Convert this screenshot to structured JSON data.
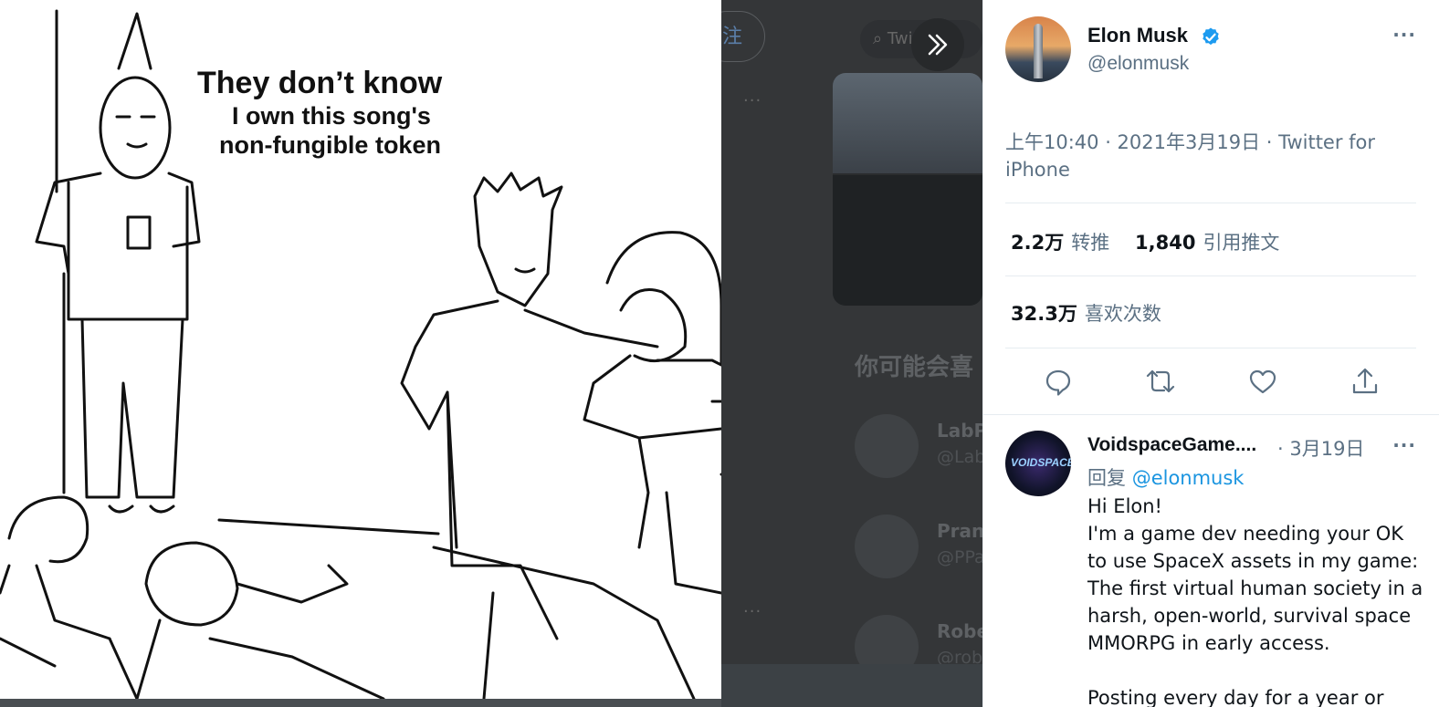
{
  "media": {
    "meme_text": {
      "line1": "They don’t know",
      "line2": "I own this song's",
      "line3": "non-fungible token"
    },
    "expand_icon": "chevrons-right-icon"
  },
  "backdrop": {
    "follow_label": "注",
    "search_placeholder": "Twi",
    "more_dots": "···",
    "section_heading": "你可能会喜",
    "suggested_users": [
      {
        "name": "LabP",
        "handle": "@Lab"
      },
      {
        "name": "Prana",
        "handle": "@PPa"
      },
      {
        "name": "Robe",
        "handle": "@rob"
      }
    ]
  },
  "tweet": {
    "author_name": "Elon Musk",
    "author_handle": "@elonmusk",
    "verified_icon": "verified-badge-icon",
    "more_icon": "more-dots-icon",
    "more_label": "···",
    "timestamp": "上午10:40 · 2021年3月19日 · Twitter for iPhone",
    "retweets_count": "2.2万",
    "retweets_label": "转推",
    "quotes_count": "1,840",
    "quotes_label": "引用推文",
    "likes_count": "32.3万",
    "likes_label": "喜欢次数",
    "actions": [
      "reply-icon",
      "retweet-icon",
      "like-icon",
      "share-icon"
    ],
    "accent_color": "#1b95e0"
  },
  "reply": {
    "author_name": "VoidspaceGame....",
    "date": "· 3月19日",
    "avatar_text": "VOIDSPACE",
    "replying_prefix": "回复",
    "replying_to": "@elonmusk",
    "more_label": "···",
    "text": "Hi Elon!\nI'm a game dev needing your OK to use SpaceX assets in my game: The first virtual human society in a harsh, open-world, survival space MMORPG in early access.\n\nPosting every day for a year or until"
  }
}
